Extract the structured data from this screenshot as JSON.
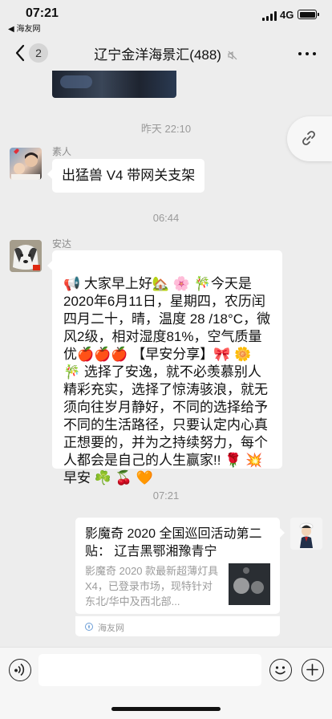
{
  "status_bar": {
    "time": "07:21",
    "back_app": "◀ 海友网",
    "network": "4G"
  },
  "nav": {
    "unread_count": "2",
    "title": "辽宁金洋海景汇(488)"
  },
  "messages": [
    {
      "type": "timestamp",
      "text": "昨天 22:10"
    },
    {
      "type": "text",
      "sender": "素人",
      "text": "出猛兽 V4 带网关支架"
    },
    {
      "type": "timestamp",
      "text": "06:44"
    },
    {
      "type": "text",
      "sender": "安达",
      "text": "📢 大家早上好🏡 🌸 🎋今天是\n2020年6月11日，星期四，农历闰\n四月二十，晴，温度 28 /18°C，微\n风2级，相对湿度81%，空气质量\n优🍎🍎🍎 【早安分享】🎀 🌼\n🎋 选择了安逸，就不必羡慕别人\n精彩充实，选择了惊涛骇浪，就无\n须向往岁月静好，不同的选择给予\n不同的生活路径，只要认定内心真\n正想要的，并为之持续努力，每个\n人都会是自己的人生赢家!! 🌹 💥\n早安 ☘️ 🍒 🧡"
    },
    {
      "type": "timestamp",
      "text": "07:21"
    },
    {
      "type": "link",
      "title": "影魔奇 2020 全国巡回活动第二贴： 辽吉黑鄂湘豫青宁",
      "desc": "影魔奇 2020 款最新超薄灯具 X4，已登录市场，现特针对东北/华中及西北部...",
      "source": "海友网"
    }
  ],
  "input": {
    "placeholder": ""
  }
}
